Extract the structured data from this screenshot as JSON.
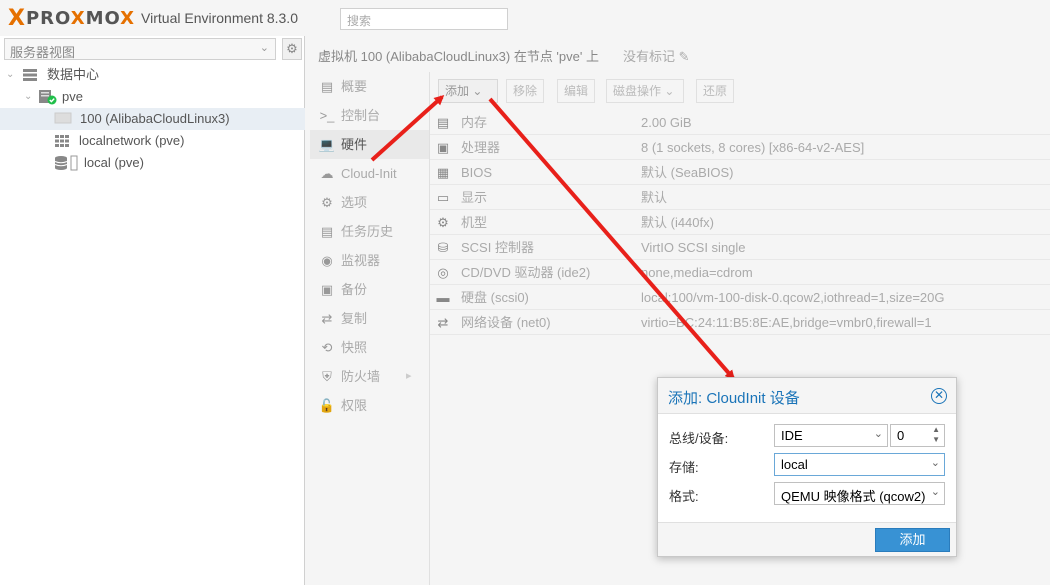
{
  "header": {
    "logo_x": "X",
    "logo_text_a": "PRO",
    "logo_text_b": "X",
    "logo_text_c": "MO",
    "logo_text_d": "X",
    "version": "Virtual Environment 8.3.0",
    "search_placeholder": "搜索"
  },
  "tree": {
    "view_select": "服务器视图",
    "rows": [
      {
        "label": "数据中心",
        "icon": "server-rack-icon"
      },
      {
        "label": "pve",
        "icon": "node-online-icon"
      },
      {
        "label": "100 (AlibabaCloudLinux3)",
        "icon": "vm-icon",
        "selected": true
      },
      {
        "label": "localnetwork (pve)",
        "icon": "network-grid-icon"
      },
      {
        "label": "local (pve)",
        "icon": "storage-icon"
      }
    ]
  },
  "content": {
    "title": "虚拟机 100 (AlibabaCloudLinux3) 在节点 'pve' 上",
    "tags": "没有标记"
  },
  "nav": {
    "items": [
      {
        "label": "概要",
        "icon": "book-icon"
      },
      {
        "label": "控制台",
        "icon": "terminal-icon"
      },
      {
        "label": "硬件",
        "icon": "desktop-icon",
        "active": true
      },
      {
        "label": "Cloud-Init",
        "icon": "cloud-icon"
      },
      {
        "label": "选项",
        "icon": "gear-icon"
      },
      {
        "label": "任务历史",
        "icon": "list-icon"
      },
      {
        "label": "监视器",
        "icon": "eye-icon"
      },
      {
        "label": "备份",
        "icon": "floppy-icon"
      },
      {
        "label": "复制",
        "icon": "retweet-icon"
      },
      {
        "label": "快照",
        "icon": "history-icon"
      },
      {
        "label": "防火墙",
        "icon": "shield-icon"
      },
      {
        "label": "权限",
        "icon": "unlock-icon"
      }
    ]
  },
  "toolbar": {
    "add": "添加",
    "remove": "移除",
    "edit": "编辑",
    "disk_action": "磁盘操作",
    "revert": "还原"
  },
  "hardware": {
    "rows": [
      {
        "name": "内存",
        "value": "2.00 GiB",
        "icon": "memory-icon"
      },
      {
        "name": "处理器",
        "value": "8 (1 sockets, 8 cores) [x86-64-v2-AES]",
        "icon": "cpu-icon"
      },
      {
        "name": "BIOS",
        "value": "默认 (SeaBIOS)",
        "icon": "microchip-icon"
      },
      {
        "name": "显示",
        "value": "默认",
        "icon": "display-icon"
      },
      {
        "name": "机型",
        "value": "默认 (i440fx)",
        "icon": "cogs-icon"
      },
      {
        "name": "SCSI 控制器",
        "value": "VirtIO SCSI single",
        "icon": "database-icon"
      },
      {
        "name": "CD/DVD 驱动器 (ide2)",
        "value": "none,media=cdrom",
        "icon": "cdrom-icon"
      },
      {
        "name": "硬盘 (scsi0)",
        "value": "local:100/vm-100-disk-0.qcow2,iothread=1,size=20G",
        "icon": "hdd-icon"
      },
      {
        "name": "网络设备 (net0)",
        "value": "virtio=BC:24:11:B5:8E:AE,bridge=vmbr0,firewall=1",
        "icon": "exchange-icon"
      }
    ]
  },
  "dialog": {
    "title": "添加: CloudInit 设备",
    "bus_label": "总线/设备:",
    "bus_value": "IDE",
    "device_value": "0",
    "storage_label": "存储:",
    "storage_value": "local",
    "format_label": "格式:",
    "format_value": "QEMU 映像格式 (qcow2)",
    "add_button": "添加"
  },
  "colors": {
    "accent": "#3892d4",
    "title_blue": "#1a74b8",
    "logo_orange": "#e57000",
    "arrow_red": "#e8201a",
    "online_green": "#21bf4b"
  }
}
